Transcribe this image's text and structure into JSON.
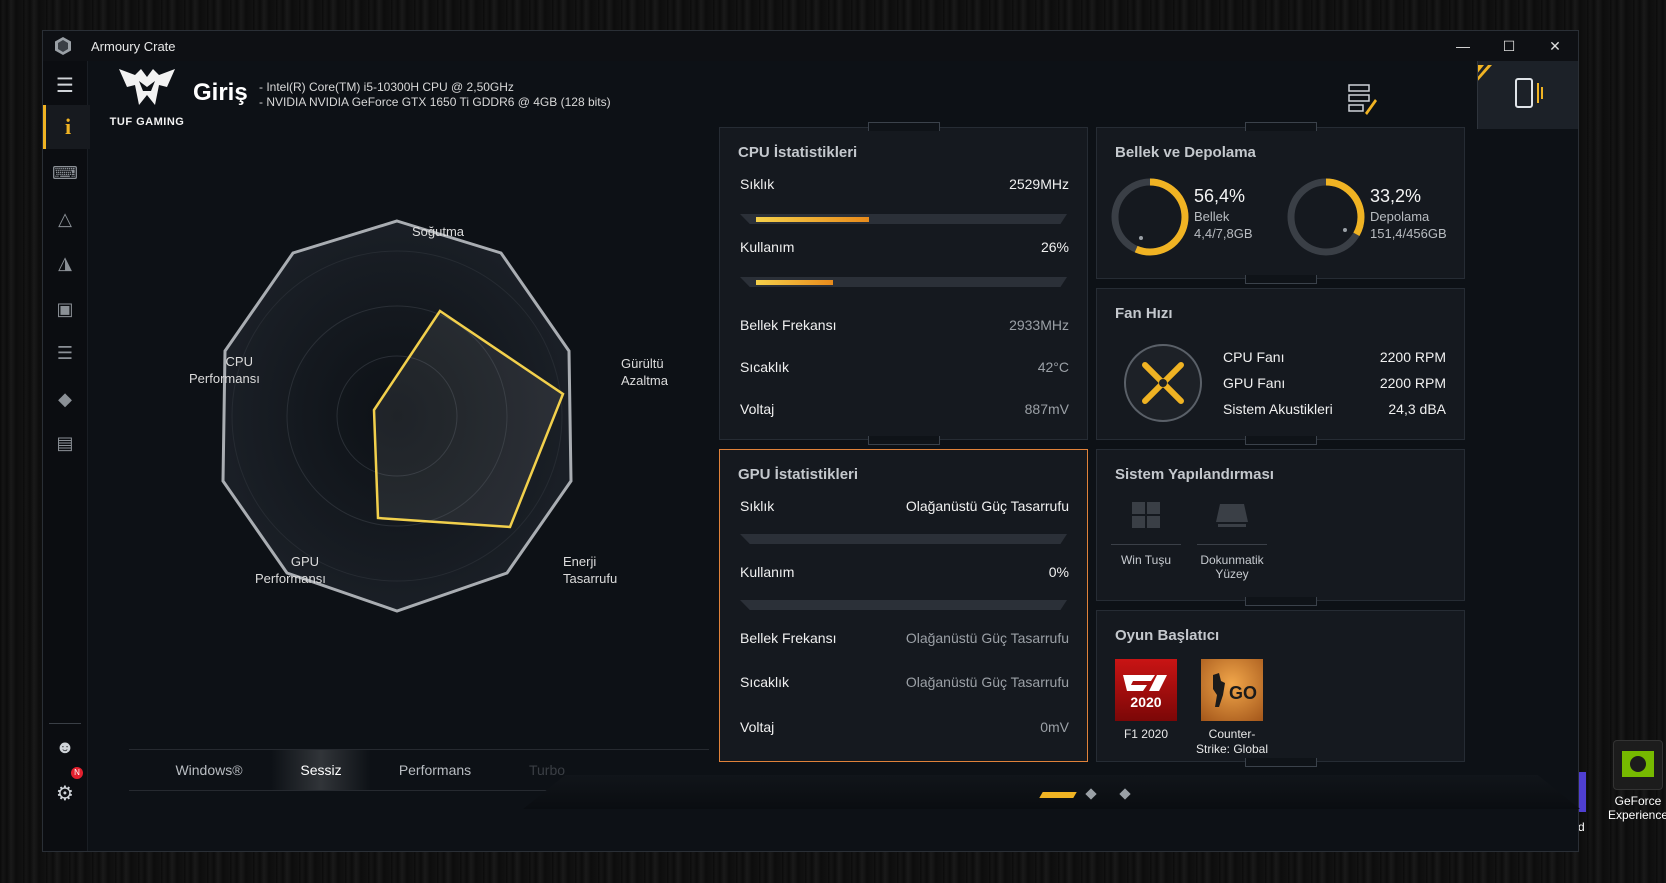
{
  "window": {
    "title": "Armoury Crate"
  },
  "header": {
    "brand": "TUF GAMING",
    "page_title": "Giriş",
    "specs": [
      "-  Intel(R) Core(TM) i5-10300H CPU @ 2,50GHz",
      "-  NVIDIA NVIDIA GeForce GTX 1650 Ti GDDR6 @ 4GB (128 bits)"
    ]
  },
  "radar": {
    "labels": {
      "top": "Soğutma",
      "right": "Gürültü\nAzaltma",
      "bottom_right": "Enerji\nTasarrufu",
      "bottom_left": "GPU\nPerformansı",
      "left": "CPU\nPerformansı"
    },
    "label_top": "Soğutma",
    "label_right": [
      "Gürültü",
      "Azaltma"
    ],
    "label_bottom_right": [
      "Enerji",
      "Tasarrufu"
    ],
    "label_bottom_left": [
      "GPU",
      "Performansı"
    ],
    "label_left": [
      "CPU",
      "Performansı"
    ]
  },
  "modes": [
    "Windows®",
    "Sessiz",
    "Performans",
    "Turbo"
  ],
  "active_mode": "Sessiz",
  "cpu": {
    "title": "CPU İstatistikleri",
    "freq_label": "Sıklık",
    "freq_value": "2529MHz",
    "freq_fill": 0.38,
    "usage_label": "Kullanım",
    "usage_value": "26%",
    "usage_fill": 0.26,
    "mem_label": "Bellek Frekansı",
    "mem_value": "2933MHz",
    "temp_label": "Sıcaklık",
    "temp_value": "42°C",
    "volt_label": "Voltaj",
    "volt_value": "887mV"
  },
  "gpu": {
    "title": "GPU İstatistikleri",
    "freq_label": "Sıklık",
    "freq_value": "Olağanüstü Güç Tasarrufu",
    "freq_fill": 0,
    "usage_label": "Kullanım",
    "usage_value": "0%",
    "usage_fill": 0,
    "mem_label": "Bellek Frekansı",
    "mem_value": "Olağanüstü Güç Tasarrufu",
    "temp_label": "Sıcaklık",
    "temp_value": "Olağanüstü Güç Tasarrufu",
    "volt_label": "Voltaj",
    "volt_value": "0mV"
  },
  "memory": {
    "title": "Bellek ve Depolama",
    "ram_percent": "56,4%",
    "ram_fraction": 0.564,
    "ram_label": "Bellek",
    "ram_detail": "4,4/7,8GB",
    "disk_percent": "33,2%",
    "disk_fraction": 0.332,
    "disk_label": "Depolama",
    "disk_detail": "151,4/456GB"
  },
  "fan": {
    "title": "Fan Hızı",
    "cpu_label": "CPU Fanı",
    "cpu_value": "2200 RPM",
    "gpu_label": "GPU Fanı",
    "gpu_value": "2200 RPM",
    "acoustic_label": "Sistem Akustikleri",
    "acoustic_value": "24,3 dBA"
  },
  "sysconfig": {
    "title": "Sistem Yapılandırması",
    "win_key": "Win Tuşu",
    "touchpad": "Dokunmatik\nYüzey",
    "touchpad_line1": "Dokunmatik",
    "touchpad_line2": "Yüzey"
  },
  "games": {
    "title": "Oyun Başlatıcı",
    "f1_name": "F1 2020",
    "f1_cover_text": "2020",
    "csgo_line1": "Counter-",
    "csgo_line2": "Strike: Global",
    "csgo_cover_text": "GO"
  },
  "desktop": {
    "icon_label_line1": "GeForce",
    "icon_label_line2": "Experience",
    "partial_text": "d"
  },
  "notification_count": "N",
  "colors": {
    "accent": "#f0b323",
    "orange": "#e88b1c",
    "highlight_border": "#e0823a",
    "radar_line": "#f2d04c"
  }
}
